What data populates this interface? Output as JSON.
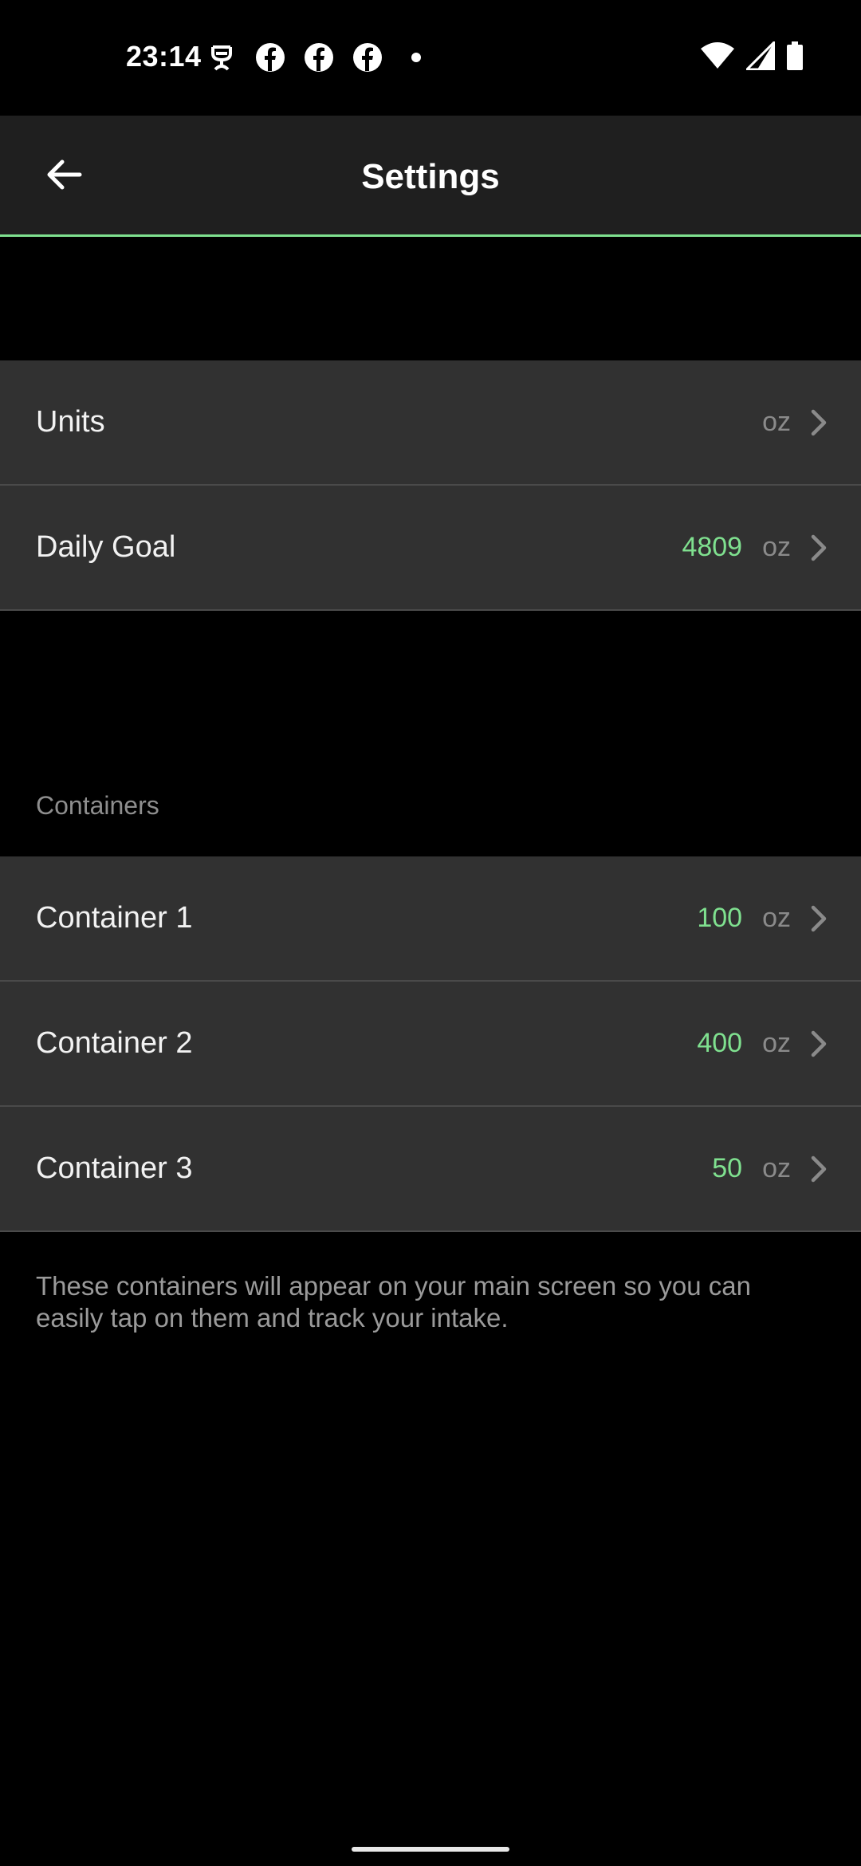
{
  "status_bar": {
    "time": "23:14",
    "left_icons": [
      "data-saver-icon",
      "facebook-icon",
      "facebook-icon",
      "facebook-icon",
      "dot-icon"
    ],
    "right_icons": [
      "wifi-icon",
      "signal-icon",
      "battery-icon"
    ]
  },
  "app_bar": {
    "title": "Settings",
    "back_icon": "arrow-left-icon",
    "accent_color": "#7fe08f"
  },
  "general": {
    "units": {
      "label": "Units",
      "unit": "oz"
    },
    "daily_goal": {
      "label": "Daily Goal",
      "value": "4809",
      "unit": "oz"
    }
  },
  "containers": {
    "header": "Containers",
    "items": [
      {
        "label": "Container 1",
        "value": "100",
        "unit": "oz"
      },
      {
        "label": "Container 2",
        "value": "400",
        "unit": "oz"
      },
      {
        "label": "Container 3",
        "value": "50",
        "unit": "oz"
      }
    ],
    "note": "These containers will appear on your main screen so you can easily tap on them and track your intake."
  }
}
